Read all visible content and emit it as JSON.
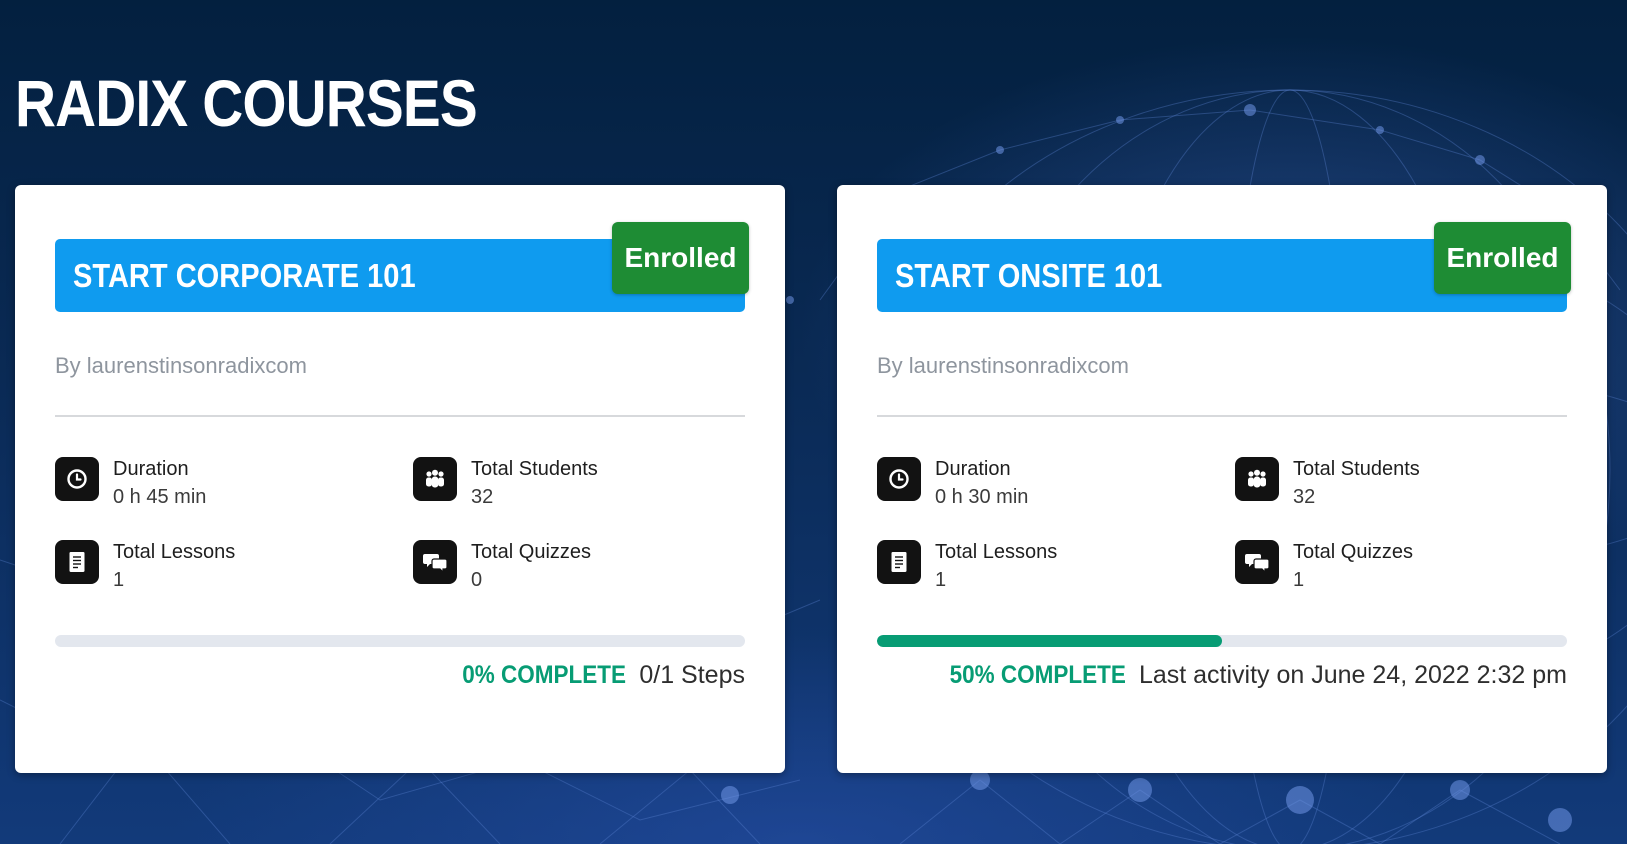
{
  "page": {
    "title": "RADIX COURSES"
  },
  "colors": {
    "title_bar": "#0f9bef",
    "enrolled_badge": "#1e8c34",
    "progress_fill": "#079c74",
    "progress_track": "#e3e7ee",
    "icon_tile": "#121212"
  },
  "courses": [
    {
      "title": "START CORPORATE 101",
      "badge": "Enrolled",
      "author": "By laurenstinsonradixcom",
      "stats": {
        "duration_label": "Duration",
        "duration_value": "0 h 45 min",
        "students_label": "Total Students",
        "students_value": "32",
        "lessons_label": "Total Lessons",
        "lessons_value": "1",
        "quizzes_label": "Total Quizzes",
        "quizzes_value": "0"
      },
      "icons": {
        "duration": "clock-icon",
        "students": "students-icon",
        "lessons": "document-icon",
        "quizzes": "chat-bubbles-icon"
      },
      "progress_percent": 0,
      "progress_label": "0% COMPLETE",
      "progress_extra": "0/1 Steps"
    },
    {
      "title": "START ONSITE 101",
      "badge": "Enrolled",
      "author": "By laurenstinsonradixcom",
      "stats": {
        "duration_label": "Duration",
        "duration_value": "0 h 30 min",
        "students_label": "Total Students",
        "students_value": "32",
        "lessons_label": "Total Lessons",
        "lessons_value": "1",
        "quizzes_label": "Total Quizzes",
        "quizzes_value": "1"
      },
      "icons": {
        "duration": "clock-icon",
        "students": "students-icon",
        "lessons": "document-icon",
        "quizzes": "chat-bubbles-icon"
      },
      "progress_percent": 50,
      "progress_label": "50% COMPLETE",
      "progress_extra": "Last activity on June 24, 2022 2:32 pm"
    }
  ]
}
